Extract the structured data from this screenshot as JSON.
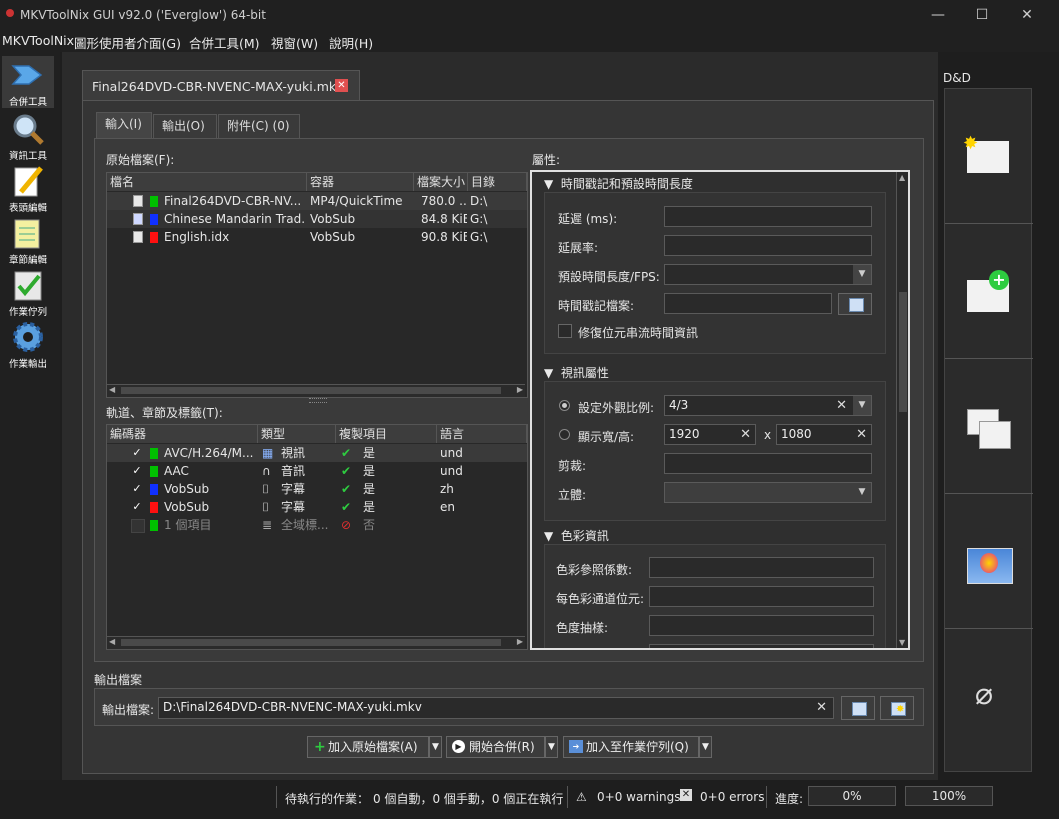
{
  "window": {
    "title": "MKVToolNix GUI v92.0 ('Everglow') 64-bit",
    "minimize": "—",
    "maximize": "☐",
    "close": "✕"
  },
  "menu": [
    "MKVToolNix",
    "圖形使用者介面(G)",
    "合併工具(M)",
    "視窗(W)",
    "說明(H)"
  ],
  "toolbar": {
    "items": [
      {
        "label": "合併工具",
        "icon": "merge-icon",
        "active": true
      },
      {
        "label": "資訊工具",
        "icon": "magnifier-icon"
      },
      {
        "label": "表頭編輯",
        "icon": "pencil-icon"
      },
      {
        "label": "章節編輯",
        "icon": "notepad-icon"
      },
      {
        "label": "作業佇列",
        "icon": "checklist-icon"
      },
      {
        "label": "作業輸出",
        "icon": "gear-icon"
      }
    ]
  },
  "doc_tab": {
    "label": "Final264DVD-CBR-NVENC-MAX-yuki.mkv",
    "close": "✕"
  },
  "sub_tabs": [
    "輸入(I)",
    "輸出(O)",
    "附件(C) (0)"
  ],
  "sources": {
    "label": "原始檔案(F):",
    "columns": [
      "檔名",
      "容器",
      "檔案大小",
      "目錄"
    ],
    "rows": [
      {
        "name": "Final264DVD-CBR-NV...",
        "container": "MP4/QuickTime",
        "size": "780.0 ...",
        "dir": "D:\\",
        "color": "#00c000"
      },
      {
        "name": "Chinese Mandarin Trad...",
        "container": "VobSub",
        "size": "84.8 KiB",
        "dir": "G:\\",
        "color": "#1030ff"
      },
      {
        "name": "English.idx",
        "container": "VobSub",
        "size": "90.8 KiB",
        "dir": "G:\\",
        "color": "#ff1010"
      }
    ]
  },
  "tracks": {
    "label": "軌道、章節及標籤(T):",
    "columns": [
      "編碼器",
      "類型",
      "複製項目",
      "語言"
    ],
    "rows": [
      {
        "codec": "AVC/H.264/M...",
        "type": "視訊",
        "copy": "是",
        "lang": "und",
        "color": "#00c000",
        "checked": true
      },
      {
        "codec": "AAC",
        "type": "音訊",
        "copy": "是",
        "lang": "und",
        "color": "#00c000",
        "checked": true
      },
      {
        "codec": "VobSub",
        "type": "字幕",
        "copy": "是",
        "lang": "zh",
        "color": "#1030ff",
        "checked": true
      },
      {
        "codec": "VobSub",
        "type": "字幕",
        "copy": "是",
        "lang": "en",
        "color": "#ff1010",
        "checked": true
      },
      {
        "codec": "1 個項目",
        "type": "全域標...",
        "copy": "否",
        "lang": "",
        "color": "#00c000",
        "checked": false
      }
    ]
  },
  "properties": {
    "label": "屬性:",
    "timestamps": {
      "title": "時間戳記和預設時間長度",
      "delay": "延遲 (ms):",
      "stretch": "延展率:",
      "default_duration": "預設時間長度/FPS:",
      "timestamp_file": "時間戳記檔案:",
      "fix_bitstream": "修復位元串流時間資訊"
    },
    "video": {
      "title": "視訊屬性",
      "aspect_ratio": "設定外觀比例:",
      "aspect_value": "4/3",
      "display_wh": "顯示寬/高:",
      "width": "1920",
      "times": "x",
      "height": "1080",
      "crop": "剪裁:",
      "stereo": "立體:"
    },
    "color": {
      "title": "色彩資訊",
      "matrix": "色彩參照係數:",
      "bits": "每色彩通道位元:",
      "chroma": "色度抽樣:"
    }
  },
  "output": {
    "section": "輸出檔案",
    "label": "輸出檔案:",
    "value": "D:\\Final264DVD-CBR-NVENC-MAX-yuki.mkv"
  },
  "actions": {
    "add": "加入原始檔案(A)",
    "start": "開始合併(R)",
    "queue": "加入至作業佇列(Q)"
  },
  "dnd": {
    "label": "D&D"
  },
  "status": {
    "pending_label": "待執行的作業：",
    "pending_value": "0 個自動，0 個手動，0 個正在執行",
    "warnings": "0+0 warnings",
    "errors": "0+0 errors",
    "progress_label": "進度:",
    "progress_value": "0%",
    "total_value": "100%"
  }
}
